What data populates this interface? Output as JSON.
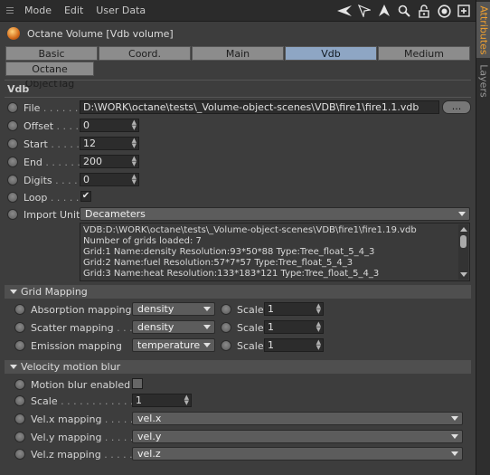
{
  "menu": {
    "items": [
      "Mode",
      "Edit",
      "User Data"
    ]
  },
  "toolbar": {
    "icons": [
      "arrow-left-icon",
      "cursor-icon",
      "up-arrow-icon",
      "search-icon",
      "lock-icon",
      "target-icon",
      "new-window-icon"
    ]
  },
  "side_tabs": {
    "attributes": "Attributes",
    "layers": "Layers"
  },
  "object": {
    "title": "Octane Volume [Vdb volume]"
  },
  "tabs": [
    "Basic",
    "Coord.",
    "Main",
    "Vdb",
    "Medium"
  ],
  "active_tab": "Vdb",
  "subtab": "Octane ObjectTag",
  "section": "Vdb",
  "vdb": {
    "file_label": "File",
    "file_value": "D:\\WORK\\octane\\tests\\_Volume-object-scenes\\VDB\\fire1\\fire1.1.vdb",
    "browse_label": "...",
    "offset_label": "Offset",
    "offset_value": "0",
    "start_label": "Start",
    "start_value": "12",
    "end_label": "End",
    "end_value": "200",
    "digits_label": "Digits",
    "digits_value": "0",
    "loop_label": "Loop",
    "loop_checked": "✔",
    "import_unit_label": "Import Unit",
    "import_unit_value": "Decameters",
    "info_lines": [
      "VDB:D:\\WORK\\octane\\tests\\_Volume-object-scenes\\VDB\\fire1\\fire1.19.vdb",
      "Number of grids loaded: 7",
      "Grid:1  Name:density  Resolution:93*50*88  Type:Tree_float_5_4_3",
      "Grid:2  Name:fuel  Resolution:57*7*57  Type:Tree_float_5_4_3",
      "Grid:3  Name:heat  Resolution:133*183*121  Type:Tree_float_5_4_3"
    ]
  },
  "grid_mapping": {
    "title": "Grid Mapping",
    "absorption_label": "Absorption mapping",
    "absorption_value": "density",
    "scatter_label": "Scatter mapping",
    "scatter_value": "density",
    "emission_label": "Emission mapping",
    "emission_value": "temperature",
    "scale_label": "Scale",
    "scale_values": [
      "1",
      "1",
      "1"
    ]
  },
  "velocity": {
    "title": "Velocity motion blur",
    "enabled_label": "Motion blur enabled",
    "scale_label": "Scale",
    "scale_value": "1",
    "velx_label": "Vel.x mapping",
    "velx_value": "vel.x",
    "vely_label": "Vel.y mapping",
    "vely_value": "vel.y",
    "velz_label": "Vel.z mapping",
    "velz_value": "vel.z"
  }
}
